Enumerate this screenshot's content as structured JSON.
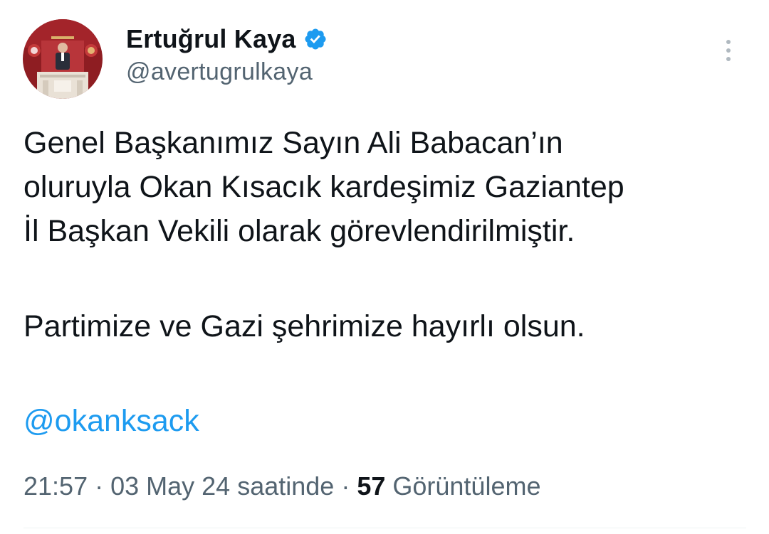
{
  "author": {
    "display_name": "Ertuğrul Kaya",
    "handle": "@avertugrulkaya",
    "verified": true,
    "avatar_icon": "profile-photo-parliament-podium"
  },
  "tweet": {
    "lines": [
      "Genel Başkanımız Sayın Ali Babacan’ın",
      "oluruyla Okan Kısacık kardeşimiz Gaziantep",
      "İl Başkan Vekili olarak görevlendirilmiştir."
    ],
    "paragraph2": "Partimize ve Gazi şehrimize hayırlı olsun.",
    "mention": "@okanksack"
  },
  "meta": {
    "time": "21:57",
    "sep1": " · ",
    "date_text": "03 May 24 saatinde",
    "sep2": " · ",
    "views": "57",
    "views_label": " Görüntüleme"
  },
  "icons": {
    "verified": "verified-badge-icon",
    "more": "more-vertical-icon"
  },
  "colors": {
    "link": "#1d9bf0",
    "secondary_text": "#536471",
    "primary_text": "#0f1419",
    "verified": "#1d9bf0"
  }
}
